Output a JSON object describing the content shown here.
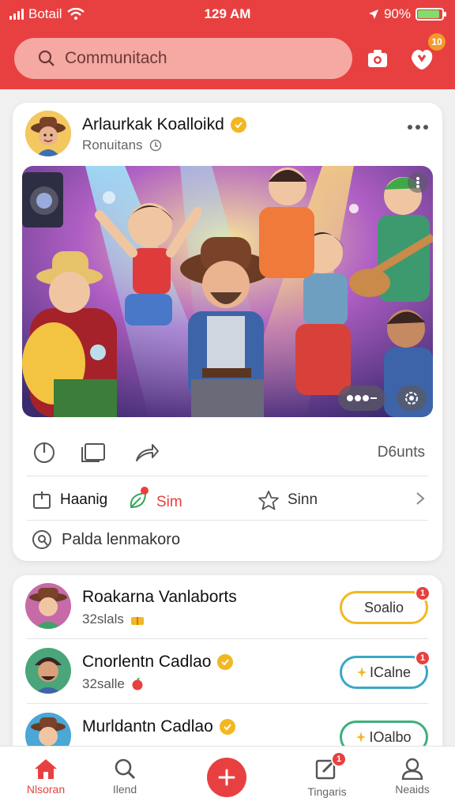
{
  "colors": {
    "brand": "#e84040",
    "accent_gold": "#f2b822",
    "badge_orange": "#f59a2a",
    "battery_green": "#7ee06a"
  },
  "status_bar": {
    "carrier": "Botail",
    "time": "129 AM",
    "battery": "90%",
    "battery_level": 0.9
  },
  "header": {
    "search": {
      "placeholder": "Communitach",
      "icon": "search-icon"
    },
    "camera_icon": "camera-icon",
    "notifications": {
      "icon": "notification-icon",
      "badge": "10"
    }
  },
  "post": {
    "author": "Arlaurkak Koalloikd",
    "subtitle": "Ronuitans",
    "counts": "D6unts",
    "options": {
      "save": "Haanig",
      "first": "Sim",
      "second": "Sinn"
    },
    "location": "Palda lenmakoro",
    "image_alt_icons": [
      "more-icon",
      "settings-icon"
    ]
  },
  "people": [
    {
      "name": "Roakarna Vanlaborts",
      "sub": "32slals",
      "button": "Soalio",
      "badge": "1",
      "button_border": "#f2b822"
    },
    {
      "name": "Cnorlentn Cadlao",
      "sub": "32salle",
      "button": "ICalne",
      "badge": "1",
      "button_border": "#3aa7c7"
    },
    {
      "name": "Murldantn Cadlao",
      "sub": "",
      "button": "IOalbo",
      "badge": "",
      "button_border": "#3fb07a"
    }
  ],
  "nav": {
    "home": "Nlsoran",
    "search": "Ilend",
    "messages": "Tingaris",
    "messages_badge": "1",
    "profile": "Neaids"
  }
}
